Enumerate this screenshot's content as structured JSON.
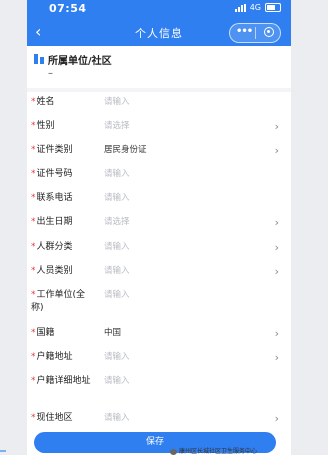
{
  "status_bar": {
    "time": "07:54",
    "network": "4G"
  },
  "navbar": {
    "back_icon": "chevron-left-icon",
    "title": "个人信息"
  },
  "unit_section": {
    "label": "所属单位/社区",
    "value": "–"
  },
  "form": {
    "fields": [
      {
        "label": "姓名",
        "required": true,
        "value": "请输入",
        "placeholder": true,
        "arrow": false
      },
      {
        "label": "性别",
        "required": true,
        "value": "请选择",
        "placeholder": true,
        "arrow": true
      },
      {
        "label": "证件类别",
        "required": true,
        "value": "居民身份证",
        "placeholder": false,
        "arrow": true
      },
      {
        "label": "证件号码",
        "required": true,
        "value": "请输入",
        "placeholder": true,
        "arrow": false
      },
      {
        "label": "联系电话",
        "required": true,
        "value": "请输入",
        "placeholder": true,
        "arrow": false
      },
      {
        "label": "出生日期",
        "required": true,
        "value": "请选择",
        "placeholder": true,
        "arrow": true
      },
      {
        "label": "人群分类",
        "required": true,
        "value": "请输入",
        "placeholder": true,
        "arrow": true
      },
      {
        "label": "人员类别",
        "required": true,
        "value": "请输入",
        "placeholder": true,
        "arrow": true
      },
      {
        "label": "工作单位(全称)",
        "required": true,
        "value": "请输入",
        "placeholder": true,
        "arrow": false
      },
      {
        "label": "国籍",
        "required": true,
        "value": "中国",
        "placeholder": false,
        "arrow": true
      },
      {
        "label": "户籍地址",
        "required": true,
        "value": "请输入",
        "placeholder": true,
        "arrow": true
      },
      {
        "label": "户籍详细地址",
        "required": true,
        "value": "请输入",
        "placeholder": true,
        "arrow": false
      },
      {
        "label": "现住地区",
        "required": true,
        "value": "请输入",
        "placeholder": true,
        "arrow": true
      }
    ]
  },
  "save_button": {
    "label": "保存"
  },
  "watermark": {
    "text": "康州区长城社区卫生服务中心"
  },
  "colors": {
    "primary": "#2f7ff0",
    "required": "#e13b3b",
    "placeholder": "#b8bcc3"
  }
}
